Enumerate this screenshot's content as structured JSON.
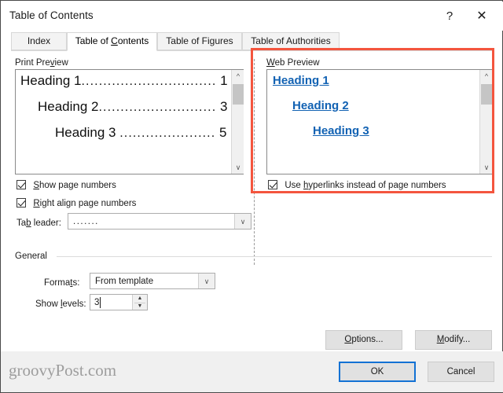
{
  "window": {
    "title": "Table of Contents",
    "help_icon": "question-mark-icon",
    "close_icon": "close-icon"
  },
  "tabs": [
    {
      "label": "Index",
      "selected": false
    },
    {
      "label": "Table of Contents",
      "selected": true
    },
    {
      "label": "Table of Figures",
      "selected": false
    },
    {
      "label": "Table of Authorities",
      "selected": false
    }
  ],
  "print_preview": {
    "group_label": "Print Preview",
    "lines": [
      {
        "heading": "Heading 1",
        "dots": "...............................",
        "page": "1"
      },
      {
        "heading": "Heading 2",
        "dots": "...........................",
        "page": "3"
      },
      {
        "heading": "Heading 3",
        "dots": "......................",
        "page": "5"
      }
    ],
    "scroll": {
      "up_icon": "chevron-up-icon",
      "down_icon": "chevron-down-icon"
    }
  },
  "web_preview": {
    "group_label": "Web Preview",
    "links": [
      "Heading 1",
      "Heading 2",
      "Heading 3"
    ],
    "scroll": {
      "up_icon": "chevron-up-icon",
      "down_icon": "chevron-down-icon"
    }
  },
  "options_left": {
    "show_page_numbers": {
      "label": "Show page numbers",
      "checked": true
    },
    "right_align": {
      "label": "Right align page numbers",
      "checked": true
    },
    "tab_leader": {
      "label": "Tab leader:",
      "value": ".......",
      "dropdown_icon": "chevron-down-icon"
    }
  },
  "options_right": {
    "use_hyperlinks": {
      "label": "Use hyperlinks instead of page numbers",
      "checked": true
    }
  },
  "general": {
    "group_label": "General",
    "formats": {
      "label": "Formats:",
      "value": "From template",
      "dropdown_icon": "chevron-down-icon"
    },
    "show_levels": {
      "label": "Show levels:",
      "value": "3",
      "up_icon": "spinner-up-icon",
      "down_icon": "spinner-down-icon"
    }
  },
  "buttons": {
    "options": "Options...",
    "modify": "Modify...",
    "ok": "OK",
    "cancel": "Cancel"
  },
  "footer": {
    "watermark": "groovyPost.com"
  },
  "colors": {
    "highlight": "#f4553e",
    "link": "#1262b3",
    "focus": "#1372d4"
  }
}
